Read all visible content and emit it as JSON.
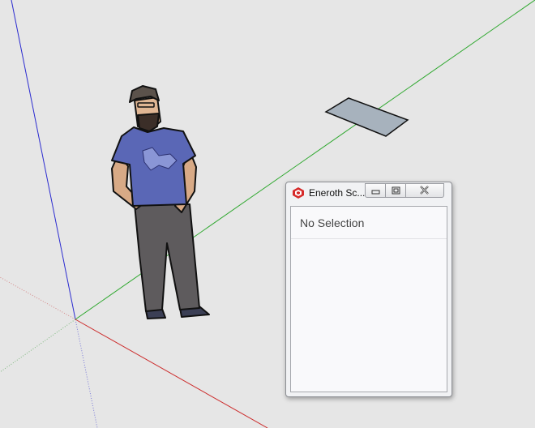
{
  "viewport": {
    "background": "#e6e6e6",
    "axes": {
      "blue": "#2b2bd0",
      "green": "#2fa82f",
      "red": "#cc2a2a"
    }
  },
  "dialog": {
    "title": "Eneroth Sc...",
    "icon": "sketchup-logo-icon",
    "buttons": {
      "minimize": "minimize-icon",
      "maximize": "maximize-icon",
      "close": "close-icon"
    },
    "status": "No Selection"
  }
}
